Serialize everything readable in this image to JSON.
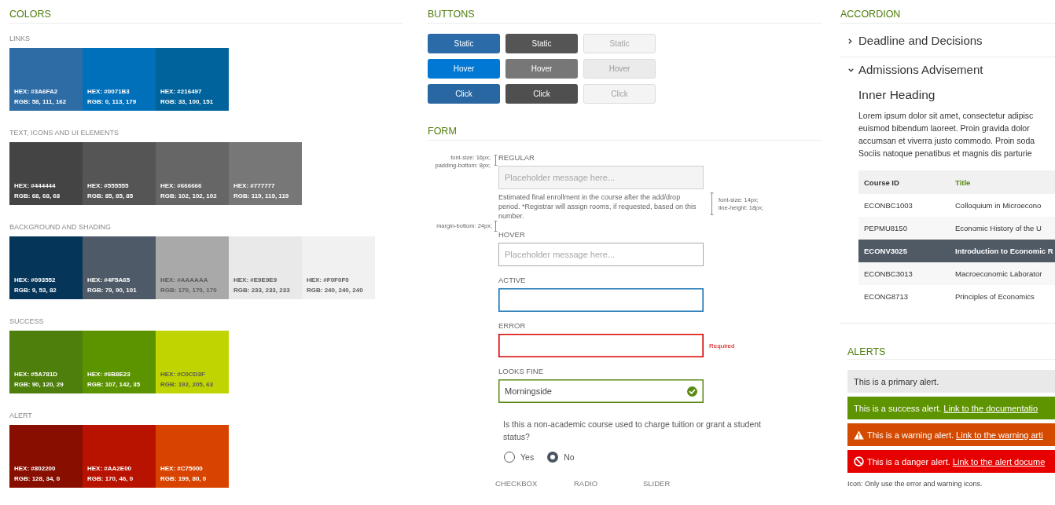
{
  "colors": {
    "title": "COLORS",
    "groups": [
      {
        "label": "LINKS",
        "swatches": [
          {
            "hex": "HEX: #3A6FA2",
            "rgb": "RGB: 58, 111, 162",
            "color": "#2e6ca6"
          },
          {
            "hex": "HEX: #0071B3",
            "rgb": "RGB: 0, 113, 179",
            "color": "#0070bb"
          },
          {
            "hex": "HEX: #216497",
            "rgb": "RGB: 33, 100, 151",
            "color": "#00639c"
          }
        ]
      },
      {
        "label": "TEXT, ICONS AND UI ELEMENTS",
        "swatches": [
          {
            "hex": "HEX: #444444",
            "rgb": "RGB: 68, 68, 68",
            "color": "#444444"
          },
          {
            "hex": "HEX: #555555",
            "rgb": "RGB: 85, 85, 85",
            "color": "#555555"
          },
          {
            "hex": "HEX: #666666",
            "rgb": "RGB: 102, 102, 102",
            "color": "#666666"
          },
          {
            "hex": "HEX: #777777",
            "rgb": "RGB: 119, 119, 119",
            "color": "#777777"
          }
        ]
      },
      {
        "label": "BACKGROUND AND SHADING",
        "swatches": [
          {
            "hex": "HEX: #093552",
            "rgb": "RGB: 9, 53, 82",
            "color": "#06355a"
          },
          {
            "hex": "HEX: #4F5A65",
            "rgb": "RGB: 79, 90, 101",
            "color": "#4e5a67"
          },
          {
            "hex": "HEX: #AAAAAA",
            "rgb": "RGB: 170, 170, 170",
            "color": "#a9a9a9"
          },
          {
            "hex": "HEX: #E9E9E9",
            "rgb": "RGB: 233, 233, 233",
            "color": "#e9e9e9"
          },
          {
            "hex": "HEX: #F0F0F0",
            "rgb": "RGB: 240, 240, 240",
            "color": "#f1f1f1"
          }
        ]
      },
      {
        "label": "SUCCESS",
        "swatches": [
          {
            "hex": "HEX: #5A781D",
            "rgb": "RGB: 90, 120, 29",
            "color": "#4e7e0b"
          },
          {
            "hex": "HEX: #6B8E23",
            "rgb": "RGB: 107, 142, 35",
            "color": "#5c9400"
          },
          {
            "hex": "HEX: #C0CD3F",
            "rgb": "RGB: 192, 205, 63",
            "color": "#bfd400"
          }
        ]
      },
      {
        "label": "ALERT",
        "swatches": [
          {
            "hex": "HEX: #802200",
            "rgb": "RGB: 128, 34, 0",
            "color": "#880e00"
          },
          {
            "hex": "HEX: #AA2E00",
            "rgb": "RGB: 170, 46, 0",
            "color": "#b81200"
          },
          {
            "hex": "HEX: #C75000",
            "rgb": "RGB: 199, 80, 0",
            "color": "#d84400"
          }
        ]
      }
    ]
  },
  "buttons": {
    "title": "BUTTONS",
    "rows": [
      {
        "kind": "static",
        "items": [
          {
            "label": "Static",
            "kind": "primary"
          },
          {
            "label": "Static",
            "kind": "secondary"
          },
          {
            "label": "Static",
            "kind": "disabled"
          }
        ]
      },
      {
        "kind": "hover",
        "items": [
          {
            "label": "Hover",
            "kind": "primary"
          },
          {
            "label": "Hover",
            "kind": "secondary"
          },
          {
            "label": "Hover",
            "kind": "disabled"
          }
        ]
      },
      {
        "kind": "click",
        "items": [
          {
            "label": "Click",
            "kind": "primary"
          },
          {
            "label": "Click",
            "kind": "secondary"
          },
          {
            "label": "Click",
            "kind": "disabled"
          }
        ]
      }
    ]
  },
  "form": {
    "title": "FORM",
    "fields": [
      {
        "label": "REGULAR",
        "kind": "regular",
        "placeholder": "Placeholder message here...",
        "label_note": [
          "font-size: 16px;",
          "padding-bottom: 8px;"
        ],
        "help": "Estimated final enrollment in the course after the add/drop period. *Registrar will assign rooms, if requested, based on this number.",
        "help_note": [
          "font-size: 14px;",
          "line-height: 18px;"
        ],
        "gap_note": [
          "margin-bottom: 24px;"
        ]
      },
      {
        "label": "HOVER",
        "kind": "hover",
        "placeholder": "Placeholder message here..."
      },
      {
        "label": "ACTIVE",
        "kind": "active"
      },
      {
        "label": "ERROR",
        "kind": "error",
        "message": "Required"
      },
      {
        "label": "LOOKS FINE",
        "kind": "valid",
        "value": "Morningside"
      }
    ],
    "question": {
      "text": "Is this a non-academic course used to charge tuition or grant a student status?",
      "options": [
        {
          "label": "Yes",
          "selected": false
        },
        {
          "label": "No",
          "selected": true
        }
      ]
    },
    "control_headings": [
      "CHECKBOX",
      "RADIO",
      "SLIDER"
    ]
  },
  "accordion": {
    "title": "ACCORDION",
    "items": [
      {
        "title": "Deadline and Decisions",
        "expanded": false
      },
      {
        "title": "Admissions Advisement",
        "expanded": true,
        "heading": "Inner Heading",
        "paragraph_lines": [
          "Lorem ipsum dolor sit amet, consectetur adipisc",
          "euismod bibendum laoreet. Proin gravida dolor",
          "accumsan et viverra justo commodo. Proin soda",
          "Sociis natoque penatibus et magnis dis parturie"
        ],
        "table": {
          "columns": [
            {
              "label": "Course ID",
              "sorted": false
            },
            {
              "label": "Title",
              "sorted": true
            }
          ],
          "rows": [
            {
              "cells": [
                "ECONBC1003",
                "Colloquium in Microecono"
              ],
              "selected": false
            },
            {
              "cells": [
                "PEPMU8150",
                "Economic History of the U"
              ],
              "selected": false
            },
            {
              "cells": [
                "ECONV3025",
                "Introduction to Economic R"
              ],
              "selected": true
            },
            {
              "cells": [
                "ECONBC3013",
                "Macroeconomic Laborator"
              ],
              "selected": false
            },
            {
              "cells": [
                "ECONG8713",
                "Principles of Economics"
              ],
              "selected": false
            }
          ]
        }
      }
    ]
  },
  "alerts": {
    "title": "ALERTS",
    "items": [
      {
        "kind": "primary",
        "text": "This is a primary alert."
      },
      {
        "kind": "success",
        "text": "This is a success alert.",
        "link": "Link to the documentatio"
      },
      {
        "kind": "warning",
        "text": "This is a warning alert.",
        "link": "Link to the warning arti"
      },
      {
        "kind": "danger",
        "text": "This is a danger alert.",
        "link": "Link to the alert docume"
      }
    ],
    "note": "Icon: Only use the error and warning icons."
  }
}
